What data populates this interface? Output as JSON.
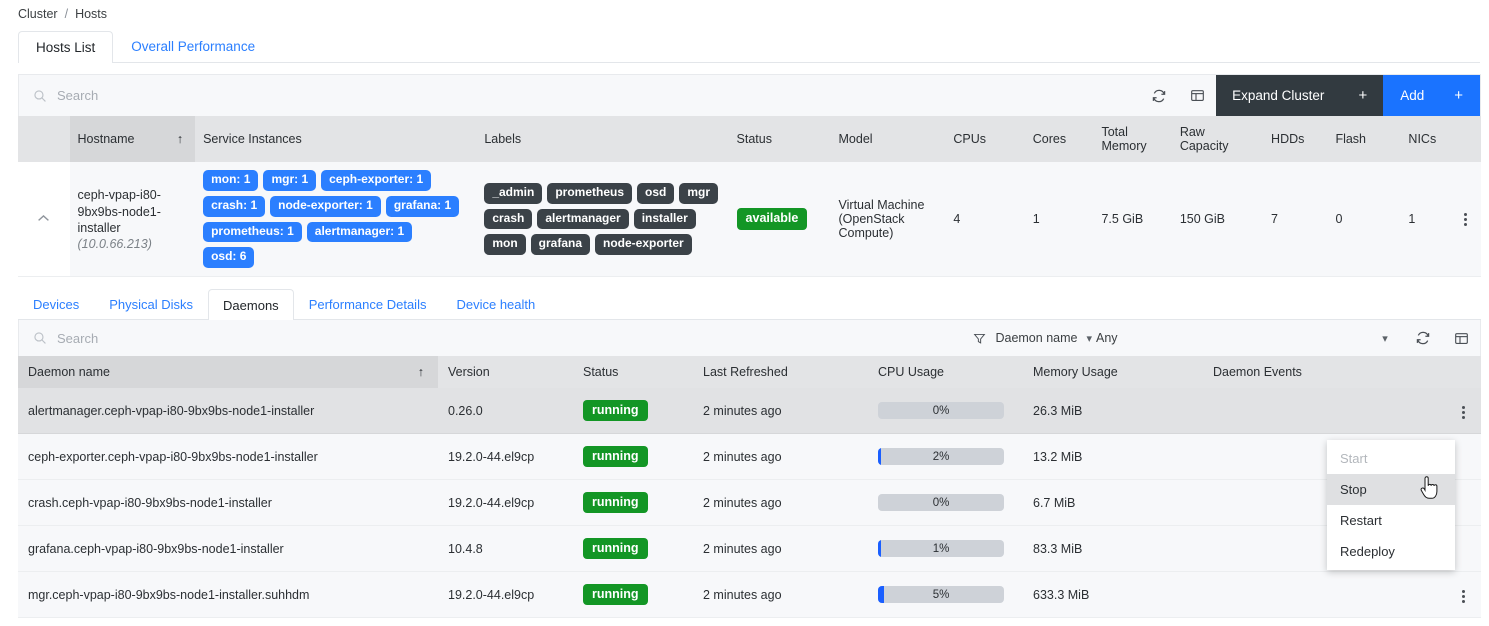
{
  "breadcrumb": {
    "root": "Cluster",
    "sep": "/",
    "current": "Hosts"
  },
  "tabs": [
    {
      "label": "Hosts List",
      "active": true
    },
    {
      "label": "Overall Performance",
      "active": false
    }
  ],
  "hosts_toolbar": {
    "search_placeholder": "Search",
    "search_value": "",
    "refresh_icon": "refresh-icon",
    "table_settings_icon": "table-settings-icon",
    "expand_cluster_label": "Expand Cluster",
    "expand_cluster_plus": "+",
    "add_label": "Add",
    "add_plus": "+",
    "expand_bg": "#323a40",
    "add_bg": "#1a73ff"
  },
  "hosts_table": {
    "columns": [
      "Hostname",
      "Service Instances",
      "Labels",
      "Status",
      "Model",
      "CPUs",
      "Cores",
      "Total Memory",
      "Raw Capacity",
      "HDDs",
      "Flash",
      "NICs"
    ],
    "sorted_column": "Hostname",
    "sort_arrow": "↑",
    "row": {
      "expander_icon": "chevron-up-icon",
      "hostname": "ceph-vpap-i80-9bx9bs-node1-installer",
      "ip": "(10.0.66.213)",
      "service_instances": [
        "mon: 1",
        "mgr: 1",
        "ceph-exporter: 1",
        "crash: 1",
        "node-exporter: 1",
        "grafana: 1",
        "prometheus: 1",
        "alertmanager: 1",
        "osd: 6"
      ],
      "labels": [
        "_admin",
        "prometheus",
        "osd",
        "mgr",
        "crash",
        "alertmanager",
        "installer",
        "mon",
        "grafana",
        "node-exporter"
      ],
      "status": "available",
      "model": "Virtual Machine (OpenStack Compute)",
      "cpus": "4",
      "cores": "1",
      "total_memory": "7.5 GiB",
      "raw_capacity": "150 GiB",
      "hdds": "7",
      "flash": "0",
      "nics": "1",
      "actions_icon": "kebab-menu-icon"
    }
  },
  "subtabs": [
    {
      "label": "Devices",
      "active": false
    },
    {
      "label": "Physical Disks",
      "active": false
    },
    {
      "label": "Daemons",
      "active": true
    },
    {
      "label": "Performance Details",
      "active": false
    },
    {
      "label": "Device health",
      "active": false
    }
  ],
  "daemons_toolbar": {
    "search_placeholder": "Search",
    "search_value": "",
    "filter_icon": "filter-icon",
    "filter_field": "Daemon name",
    "filter_value": "Any",
    "refresh_icon": "refresh-icon",
    "table_settings_icon": "table-settings-icon"
  },
  "daemons_table": {
    "columns": [
      "Daemon name",
      "Version",
      "Status",
      "Last Refreshed",
      "CPU Usage",
      "Memory Usage",
      "Daemon Events"
    ],
    "sorted_column": "Daemon name",
    "sort_arrow": "↑",
    "rows": [
      {
        "name": "alertmanager.ceph-vpap-i80-9bx9bs-node1-installer",
        "version": "0.26.0",
        "status": "running",
        "last_refreshed": "2 minutes ago",
        "cpu_label": "0%",
        "cpu_pct": 0,
        "memory": "26.3 MiB",
        "events": "",
        "highlighted": true
      },
      {
        "name": "ceph-exporter.ceph-vpap-i80-9bx9bs-node1-installer",
        "version": "19.2.0-44.el9cp",
        "status": "running",
        "last_refreshed": "2 minutes ago",
        "cpu_label": "2%",
        "cpu_pct": 2,
        "memory": "13.2 MiB",
        "events": "",
        "highlighted": false
      },
      {
        "name": "crash.ceph-vpap-i80-9bx9bs-node1-installer",
        "version": "19.2.0-44.el9cp",
        "status": "running",
        "last_refreshed": "2 minutes ago",
        "cpu_label": "0%",
        "cpu_pct": 0,
        "memory": "6.7 MiB",
        "events": "",
        "highlighted": false
      },
      {
        "name": "grafana.ceph-vpap-i80-9bx9bs-node1-installer",
        "version": "10.4.8",
        "status": "running",
        "last_refreshed": "2 minutes ago",
        "cpu_label": "1%",
        "cpu_pct": 1,
        "memory": "83.3 MiB",
        "events": "",
        "highlighted": false
      },
      {
        "name": "mgr.ceph-vpap-i80-9bx9bs-node1-installer.suhhdm",
        "version": "19.2.0-44.el9cp",
        "status": "running",
        "last_refreshed": "2 minutes ago",
        "cpu_label": "5%",
        "cpu_pct": 5,
        "memory": "633.3 MiB",
        "events": "",
        "highlighted": false
      }
    ]
  },
  "context_menu": {
    "items": [
      {
        "label": "Start",
        "state": "disabled"
      },
      {
        "label": "Stop",
        "state": "hover"
      },
      {
        "label": "Restart",
        "state": "normal"
      },
      {
        "label": "Redeploy",
        "state": "normal"
      }
    ]
  },
  "colors": {
    "accent_blue": "#2b7fff",
    "status_green": "#139625",
    "chip_dark": "#3b4248",
    "header_gray": "#e3e4e6"
  }
}
